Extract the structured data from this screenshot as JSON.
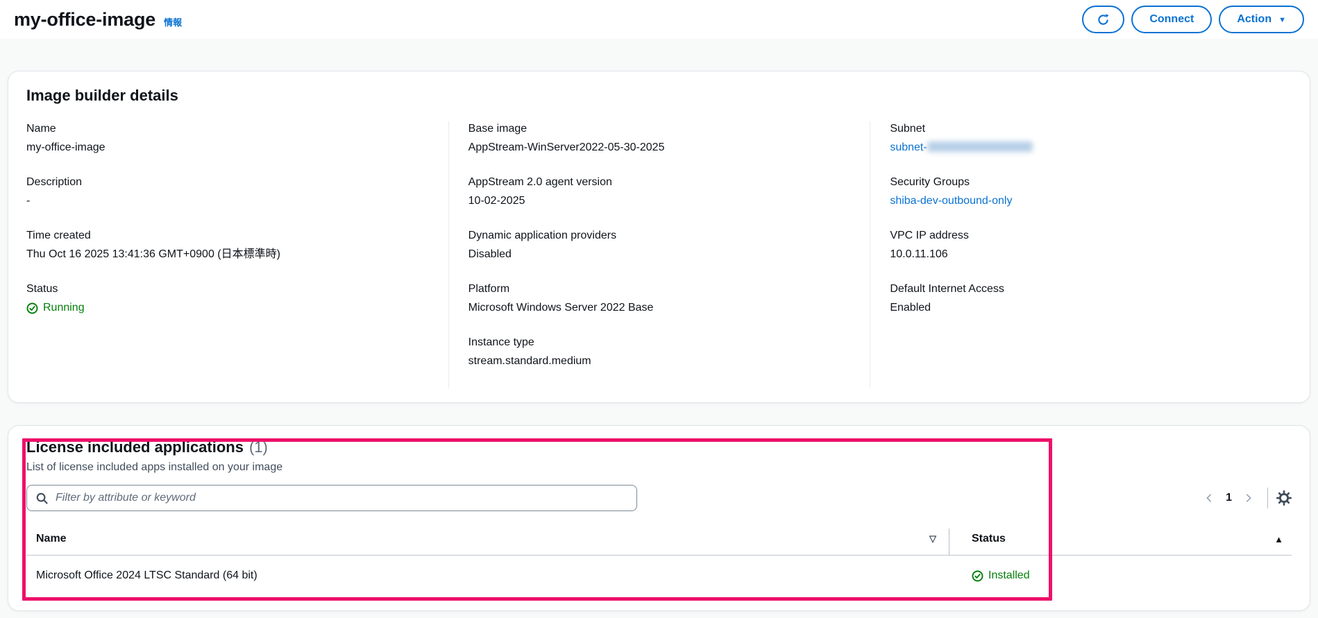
{
  "header": {
    "title": "my-office-image",
    "info_link": "情報",
    "buttons": {
      "connect": "Connect",
      "action": "Action"
    }
  },
  "details_card": {
    "title": "Image builder details",
    "col1": {
      "name_label": "Name",
      "name_value": "my-office-image",
      "description_label": "Description",
      "description_value": "-",
      "time_created_label": "Time created",
      "time_created_value": "Thu Oct 16 2025 13:41:36 GMT+0900 (日本標準時)",
      "status_label": "Status",
      "status_value": "Running"
    },
    "col2": {
      "base_image_label": "Base image",
      "base_image_value": "AppStream-WinServer2022-05-30-2025",
      "agent_version_label": "AppStream 2.0 agent version",
      "agent_version_value": "10-02-2025",
      "dap_label": "Dynamic application providers",
      "dap_value": "Disabled",
      "platform_label": "Platform",
      "platform_value": "Microsoft Windows Server 2022 Base",
      "instance_type_label": "Instance type",
      "instance_type_value": "stream.standard.medium"
    },
    "col3": {
      "subnet_label": "Subnet",
      "subnet_value_prefix": "subnet-",
      "sg_label": "Security Groups",
      "sg_value": "shiba-dev-outbound-only",
      "vpc_ip_label": "VPC IP address",
      "vpc_ip_value": "10.0.11.106",
      "dia_label": "Default Internet Access",
      "dia_value": "Enabled"
    }
  },
  "apps_card": {
    "title": "License included applications",
    "count": "(1)",
    "subtitle": "List of license included apps installed on your image",
    "filter_placeholder": "Filter by attribute or keyword",
    "pagination": {
      "page": "1"
    },
    "table": {
      "name_header": "Name",
      "status_header": "Status",
      "rows": [
        {
          "name": "Microsoft Office 2024 LTSC Standard (64 bit)",
          "status": "Installed"
        }
      ]
    }
  },
  "icons": {
    "caret_down": "▼",
    "sort_desc": "▽",
    "sort_asc": "▲"
  },
  "colors": {
    "accent": "#0972d3",
    "success": "#037f0c",
    "highlight": "#ed116b",
    "card_border": "#dfe4e9"
  }
}
